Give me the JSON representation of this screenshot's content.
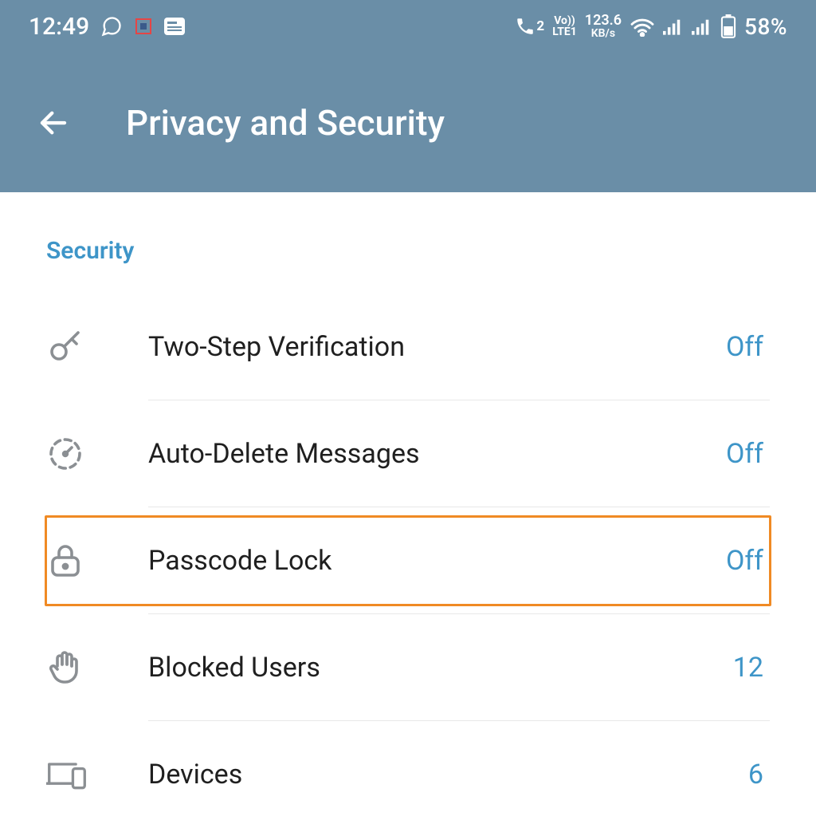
{
  "status_bar": {
    "time": "12:49",
    "network_speed_top": "123.6",
    "network_speed_bottom": "KB/s",
    "sim_label": "2",
    "lte_top": "Vo))",
    "lte_bottom": "LTE1",
    "battery_percent": "58%"
  },
  "header": {
    "title": "Privacy and Security"
  },
  "section": {
    "title": "Security",
    "items": [
      {
        "label": "Two-Step Verification",
        "value": "Off"
      },
      {
        "label": "Auto-Delete Messages",
        "value": "Off"
      },
      {
        "label": "Passcode Lock",
        "value": "Off"
      },
      {
        "label": "Blocked Users",
        "value": "12"
      },
      {
        "label": "Devices",
        "value": "6"
      }
    ]
  }
}
